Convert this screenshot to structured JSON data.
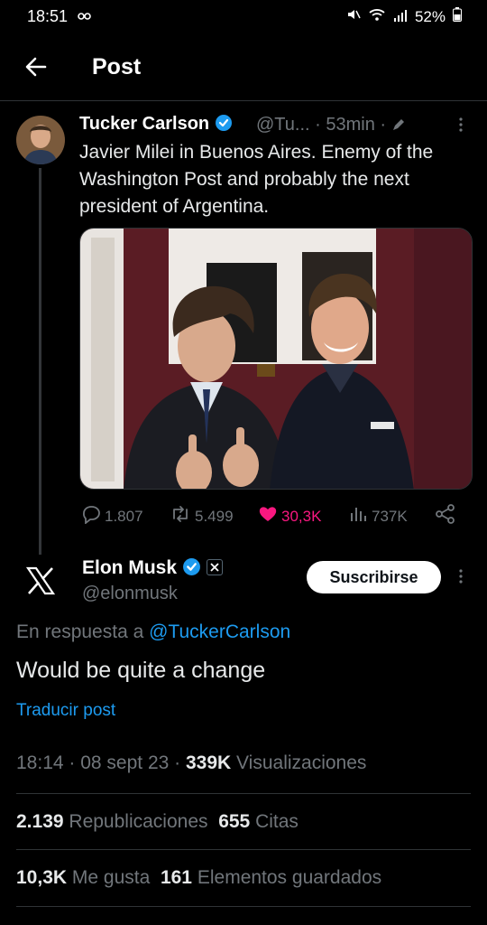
{
  "status_bar": {
    "time": "18:51",
    "battery": "52%"
  },
  "header": {
    "title": "Post"
  },
  "quoted_post": {
    "author_name": "Tucker Carlson",
    "handle": "@Tu...",
    "time": "· 53min ·",
    "text": "Javier Milei in Buenos Aires. Enemy of the Washington Post and probably the next president of Argentina.",
    "replies": "1.807",
    "reposts": "5.499",
    "likes": "30,3K",
    "views": "737K",
    "like_color": "#f91880"
  },
  "main_post": {
    "author_name": "Elon Musk",
    "handle": "@elonmusk",
    "subscribe_label": "Suscribirse",
    "reply_prefix": "En respuesta a",
    "reply_mention": "@TuckerCarlson",
    "text": "Would be quite a change",
    "translate_label": "Traducir post",
    "time": "18:14",
    "date": "08 sept 23",
    "views_count": "339K",
    "views_label": "Visualizaciones",
    "reposts_count": "2.139",
    "reposts_label": "Republicaciones",
    "quotes_count": "655",
    "quotes_label": "Citas",
    "likes_count": "10,3K",
    "likes_label": "Me gusta",
    "bookmarks_count": "161",
    "bookmarks_label": "Elementos guardados"
  },
  "colors": {
    "accent": "#1d9bf0",
    "background": "#000000",
    "muted": "#71767b"
  }
}
